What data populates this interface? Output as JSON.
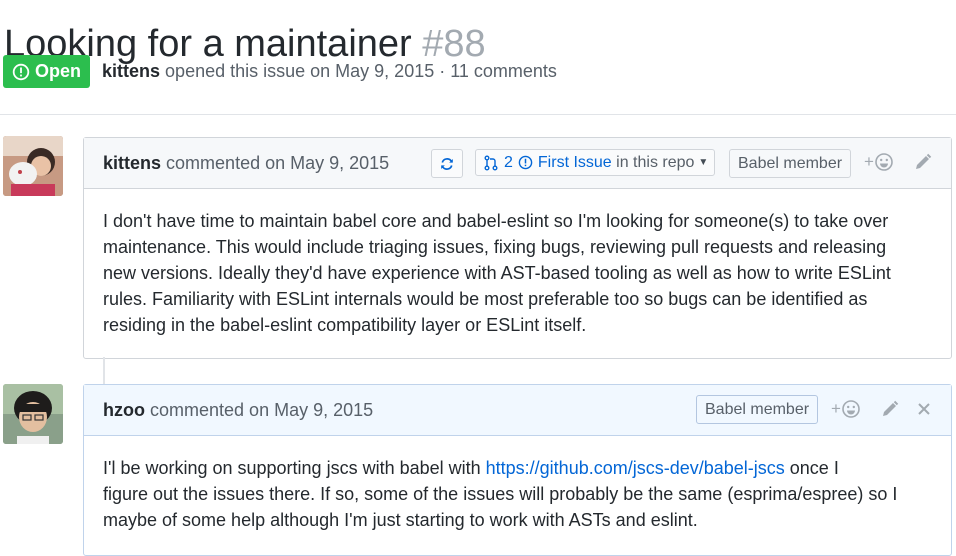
{
  "issue": {
    "title": "Looking for a maintainer",
    "number": "#88",
    "state": "Open",
    "author": "kittens",
    "meta_text": "opened this issue on May 9, 2015 · 11 comments"
  },
  "comments": [
    {
      "author": "kittens",
      "action": "commented on May 9, 2015",
      "pr_count": "2",
      "first_issue_label": "First Issue",
      "first_issue_suffix": "in this repo",
      "member_badge": "Babel member",
      "add_reaction": "+",
      "body_lines": [
        "I don't have time to maintain babel core and babel-eslint so I'm looking for someone(s) to take over",
        "maintenance. This would include triaging issues, fixing bugs, reviewing pull requests and releasing",
        "new versions. Ideally they'd have experience with AST-based tooling as well as how to write ESLint",
        "rules. Familiarity with ESLint internals would be most preferable too so bugs can be identified as",
        "residing in the babel-eslint compatibility layer or ESLint itself."
      ]
    },
    {
      "author": "hzoo",
      "action": "commented on May 9, 2015",
      "member_badge": "Babel member",
      "add_reaction": "+",
      "body_pre": "I'l be working on supporting jscs with babel with ",
      "body_link": "https://github.com/jscs-dev/babel-jscs",
      "body_post": " once I",
      "body_lines": [
        "figure out the issues there. If so, some of the issues will probably be the same (esprima/espree) so I",
        "maybe of some help although I'm just starting to work with ASTs and eslint."
      ]
    }
  ],
  "icons": {
    "open_state": "issue-opened-icon",
    "sync": "sync-icon",
    "pull_request": "git-pull-request-icon",
    "issue": "issue-opened-icon",
    "reaction": "smiley-icon",
    "edit": "pencil-icon",
    "delete": "x-icon"
  },
  "colors": {
    "open_green": "#2cbe4e",
    "link_blue": "#0366d6",
    "muted": "#586069",
    "owner_header_blue": "#f1f8ff"
  }
}
